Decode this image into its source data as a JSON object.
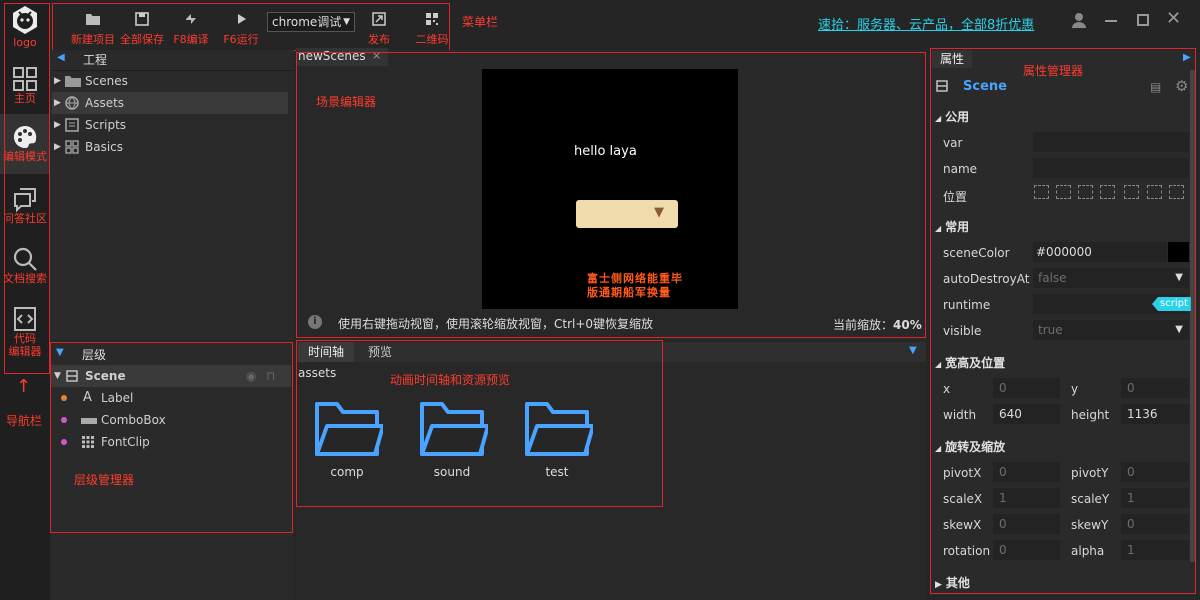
{
  "nav": {
    "logo": "logo",
    "items": [
      {
        "label": "主页",
        "icon": "grid-icon"
      },
      {
        "label": "编辑模式",
        "icon": "palette-icon"
      },
      {
        "label": "问答社区",
        "icon": "chat-icon"
      },
      {
        "label": "文档搜索",
        "icon": "search-icon"
      },
      {
        "label_line1": "代码",
        "label_line2": "编辑器",
        "icon": "code-icon"
      }
    ],
    "annotation": "导航栏"
  },
  "toolbar": {
    "new_project": "新建项目",
    "save_all": "全部保存",
    "compile": "F8编译",
    "run": "F6运行",
    "target_select": "chrome调试",
    "publish": "发布",
    "qrcode": "二维码",
    "annotation": "菜单栏"
  },
  "promo": "速拾：服务器、云产品，全部8折优惠",
  "project": {
    "title": "工程",
    "items": [
      {
        "label": "Scenes",
        "icon": "folder-icon"
      },
      {
        "label": "Assets",
        "icon": "globe-icon"
      },
      {
        "label": "Scripts",
        "icon": "script-icon"
      },
      {
        "label": "Basics",
        "icon": "components-icon"
      }
    ]
  },
  "scene_editor": {
    "tab": "newScenes",
    "tab_close": "×",
    "annotation": "场景编辑器",
    "hello_text": "hello laya",
    "fontclip_text_1": "富士侧网络能重毕",
    "fontclip_text_2": "版通期船军换量",
    "hint": "使用右键拖动视窗，使用滚轮缩放视窗，Ctrl+0键恢复缩放",
    "zoom_label": "当前缩放：",
    "zoom_value": "40%"
  },
  "hierarchy": {
    "title": "层级",
    "annotation": "层级管理器",
    "items": [
      {
        "label": "Scene"
      },
      {
        "label": "Label",
        "dot": "#e0843a"
      },
      {
        "label": "ComboBox",
        "dot": "#d455d4"
      },
      {
        "label": "FontClip",
        "dot": "#d455d4"
      }
    ]
  },
  "timeline": {
    "tab_timeline": "时间轴",
    "tab_preview": "预览",
    "path": "assets",
    "annotation": "动画时间轴和资源预览",
    "folders": [
      "comp",
      "sound",
      "test"
    ]
  },
  "properties": {
    "tab": "属性",
    "annotation": "属性管理器",
    "node_name": "Scene",
    "sections": {
      "common": "公用",
      "usual": "常用",
      "size_pos": "宽高及位置",
      "rot_scale": "旋转及缩放",
      "other": "其他"
    },
    "var_label": "var",
    "name_label": "name",
    "pos_label": "位置",
    "sceneColor_label": "sceneColor",
    "sceneColor_value": "#000000",
    "autoDestroy_label": "autoDestroyAt",
    "autoDestroy_value": "false",
    "runtime_label": "runtime",
    "runtime_tag": "script",
    "visible_label": "visible",
    "visible_value": "true",
    "x_label": "x",
    "x_value": "0",
    "y_label": "y",
    "y_value": "0",
    "width_label": "width",
    "width_value": "640",
    "height_label": "height",
    "height_value": "1136",
    "pivotX_label": "pivotX",
    "pivotX_value": "0",
    "pivotY_label": "pivotY",
    "pivotY_value": "0",
    "scaleX_label": "scaleX",
    "scaleX_value": "1",
    "scaleY_label": "scaleY",
    "scaleY_value": "1",
    "skewX_label": "skewX",
    "skewX_value": "0",
    "skewY_label": "skewY",
    "skewY_value": "0",
    "rotation_label": "rotation",
    "rotation_value": "0",
    "alpha_label": "alpha",
    "alpha_value": "1"
  },
  "colors": {
    "accent": "#4aa3ff",
    "annotation_red": "#ff3b2f",
    "promo_cyan": "#2ad1e8",
    "combo_bg": "#f0dcaa"
  }
}
